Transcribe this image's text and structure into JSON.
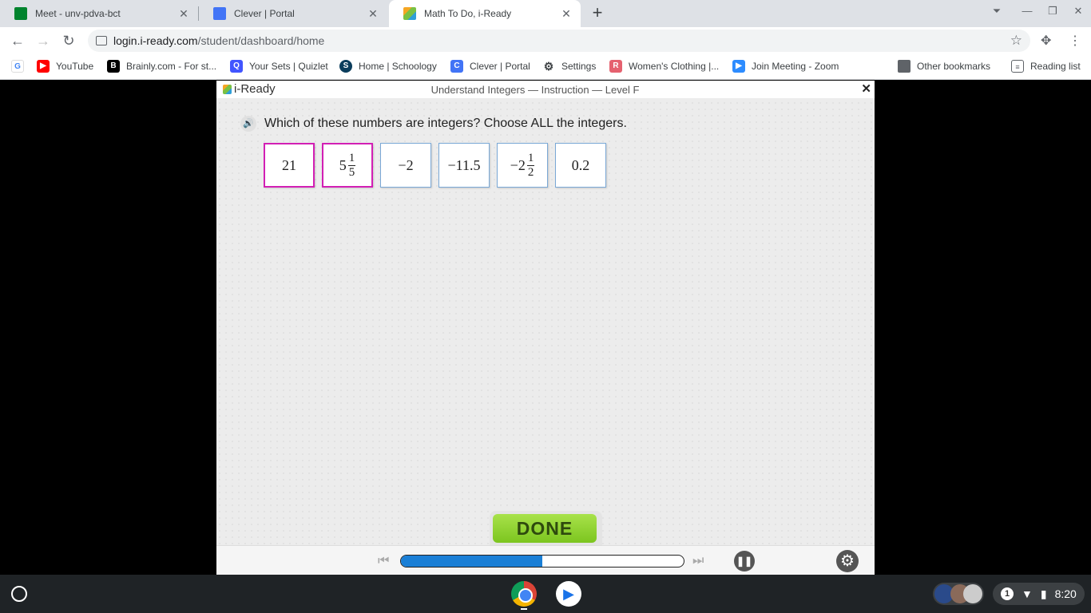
{
  "browser": {
    "tabs": [
      {
        "title": "Meet - unv-pdva-bct",
        "favicon_color": "#00832d"
      },
      {
        "title": "Clever | Portal",
        "favicon_color": "#4274f6"
      },
      {
        "title": "Math To Do, i-Ready",
        "favicon_color": "#f5a623"
      }
    ],
    "url_host": "login.i-ready.com",
    "url_path": "/student/dashboard/home",
    "bookmarks": [
      {
        "label": "YouTube",
        "icon": "youtube-icon",
        "color": "#ff0000"
      },
      {
        "label": "Brainly.com - For st...",
        "icon": "brainly-icon",
        "color": "#000000"
      },
      {
        "label": "Your Sets | Quizlet",
        "icon": "quizlet-icon",
        "color": "#4255ff"
      },
      {
        "label": "Home | Schoology",
        "icon": "schoology-icon",
        "color": "#0b3d5c"
      },
      {
        "label": "Clever | Portal",
        "icon": "clever-icon",
        "color": "#4274f6"
      },
      {
        "label": "Settings",
        "icon": "gear-icon",
        "color": "#3c4043"
      },
      {
        "label": "Women's Clothing |...",
        "icon": "shop-icon",
        "color": "#e5616f"
      },
      {
        "label": "Join Meeting - Zoom",
        "icon": "zoom-icon",
        "color": "#2d8cff"
      }
    ],
    "other_bookmarks": "Other bookmarks",
    "reading_list": "Reading list"
  },
  "lesson": {
    "logo": "i-Ready",
    "title": "Understand Integers — Instruction — Level F",
    "question": "Which of these numbers are integers? Choose ALL the integers.",
    "choices": [
      {
        "whole": "21",
        "num": "",
        "den": "",
        "selected": true
      },
      {
        "whole": "5",
        "num": "1",
        "den": "5",
        "selected": true
      },
      {
        "whole": "−2",
        "num": "",
        "den": "",
        "selected": false
      },
      {
        "whole": "−11.5",
        "num": "",
        "den": "",
        "selected": false
      },
      {
        "whole": "−2",
        "num": "1",
        "den": "2",
        "selected": false
      },
      {
        "whole": "0.2",
        "num": "",
        "den": "",
        "selected": false
      }
    ],
    "done_label": "DONE",
    "progress_fraction": 0.5
  },
  "shelf": {
    "tray_badge": "1",
    "time": "8:20"
  }
}
